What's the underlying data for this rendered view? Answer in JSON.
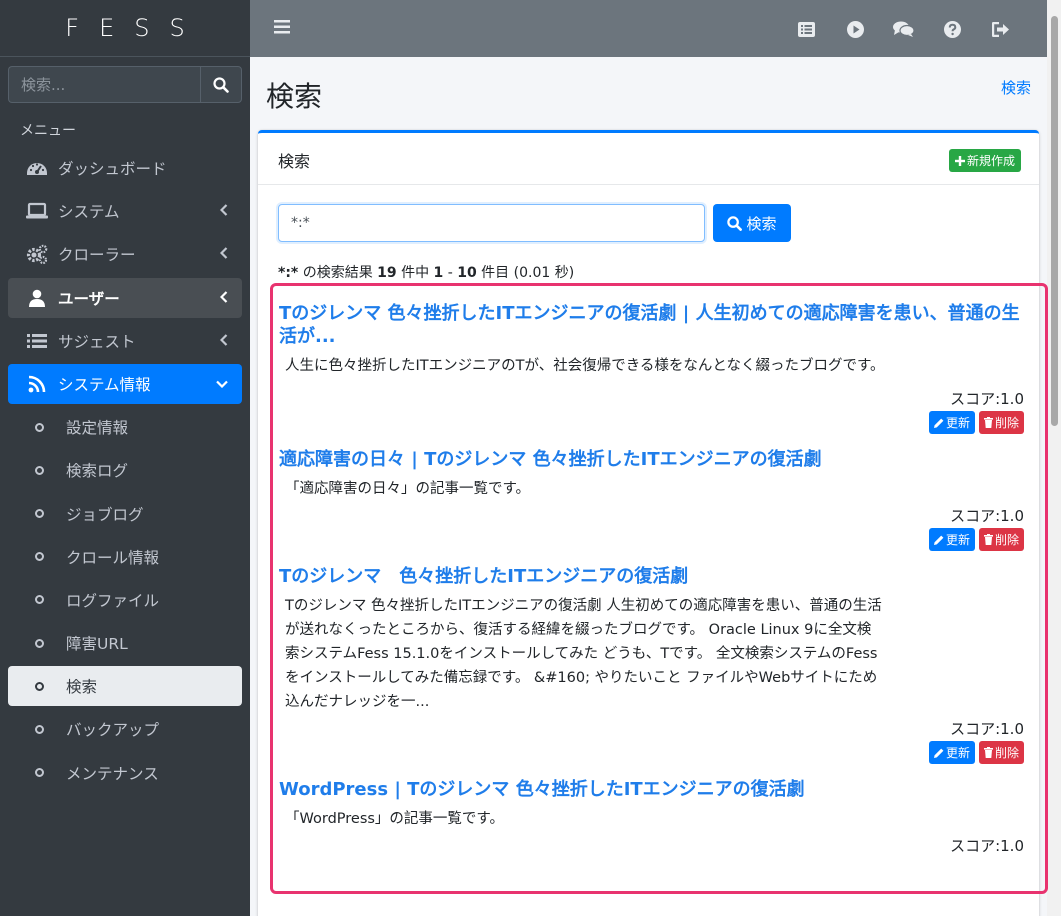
{
  "brand": "FESS",
  "sidebar": {
    "search_placeholder": "検索...",
    "header": "メニュー",
    "items": [
      {
        "label": "ダッシュボード",
        "icon": "dashboard-icon"
      },
      {
        "label": "システム",
        "icon": "laptop-icon"
      },
      {
        "label": "クローラー",
        "icon": "cogs-icon"
      },
      {
        "label": "ユーザー",
        "icon": "user-icon"
      },
      {
        "label": "サジェスト",
        "icon": "list-icon"
      },
      {
        "label": "システム情報",
        "icon": "rss-icon"
      }
    ],
    "subitems": [
      "設定情報",
      "検索ログ",
      "ジョブログ",
      "クロール情報",
      "ログファイル",
      "障害URL",
      "検索",
      "バックアップ",
      "メンテナンス"
    ]
  },
  "page": {
    "title": "検索",
    "breadcrumb": "検索"
  },
  "card": {
    "title": "検索",
    "new_label": "新規作成",
    "query": "*:*",
    "search_label": "検索",
    "result_info": {
      "query": "*:*",
      "t1": " の検索結果 ",
      "total": "19",
      "t2": " 件中 ",
      "from": "1",
      "t3": " - ",
      "to": "10",
      "t4": " 件目 (0.01 秒)"
    }
  },
  "results": [
    {
      "title": "Tのジレンマ 色々挫折したITエンジニアの復活劇 | 人生初めての適応障害を患い、普通の生活が...",
      "desc": "人生に色々挫折したITエンジニアのTが、社会復帰できる様をなんとなく綴ったブログです。",
      "score": "スコア:1.0"
    },
    {
      "title": "適応障害の日々 | Tのジレンマ 色々挫折したITエンジニアの復活劇",
      "desc": "「適応障害の日々」の記事一覧です。",
      "score": "スコア:1.0"
    },
    {
      "title": "Tのジレンマ　色々挫折したITエンジニアの復活劇",
      "desc": "Tのジレンマ 色々挫折したITエンジニアの復活劇 人生初めての適応障害を患い、普通の生活が送れなくったところから、復活する経緯を綴ったブログです。 Oracle Linux 9に全文検索システムFess 15.1.0をインストールしてみた どうも、Tです。 全文検索システムのFessをインストールしてみた備忘録です。 &#160; やりたいこと ファイルやWebサイトにため込んだナレッジを一...",
      "score": "スコア:1.0"
    },
    {
      "title": "WordPress | Tのジレンマ 色々挫折したITエンジニアの復活劇",
      "desc": "「WordPress」の記事一覧です。",
      "score": "スコア:1.0"
    }
  ],
  "actions": {
    "edit": "更新",
    "delete": "削除"
  }
}
